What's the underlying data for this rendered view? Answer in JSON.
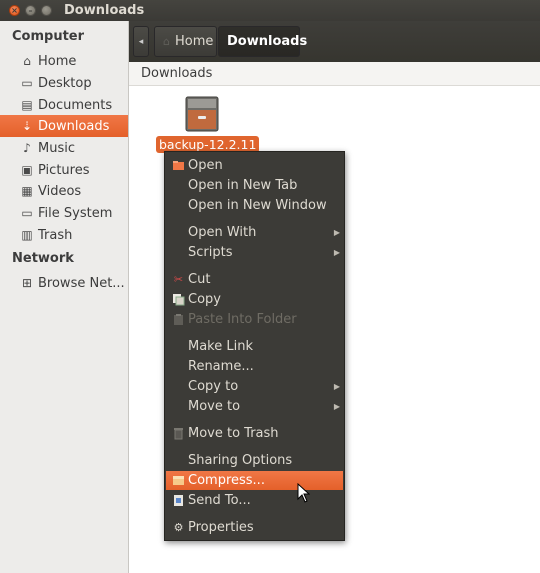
{
  "window": {
    "title": "Downloads"
  },
  "sidebar": {
    "sections": [
      {
        "heading": "Computer",
        "items": [
          {
            "label": "Home",
            "icon": "home-icon"
          },
          {
            "label": "Desktop",
            "icon": "desktop-icon"
          },
          {
            "label": "Documents",
            "icon": "documents-icon"
          },
          {
            "label": "Downloads",
            "icon": "downloads-icon",
            "active": true
          },
          {
            "label": "Music",
            "icon": "music-icon"
          },
          {
            "label": "Pictures",
            "icon": "pictures-icon"
          },
          {
            "label": "Videos",
            "icon": "videos-icon"
          },
          {
            "label": "File System",
            "icon": "filesystem-icon"
          },
          {
            "label": "Trash",
            "icon": "trash-icon"
          }
        ]
      },
      {
        "heading": "Network",
        "items": [
          {
            "label": "Browse Net...",
            "icon": "network-icon"
          }
        ]
      }
    ]
  },
  "pathbar": {
    "home": "Home",
    "current": "Downloads"
  },
  "content": {
    "location": "Downloads",
    "file": {
      "name": "backup-12.2.11",
      "icon": "archive-icon"
    }
  },
  "context_menu": {
    "items": [
      {
        "label": "Open",
        "icon": "open-folder-icon"
      },
      {
        "label": "Open in New Tab"
      },
      {
        "label": "Open in New Window"
      },
      {
        "label": "Open With",
        "submenu": true
      },
      {
        "label": "Scripts",
        "submenu": true
      },
      {
        "label": "Cut",
        "icon": "cut-icon"
      },
      {
        "label": "Copy",
        "icon": "copy-icon"
      },
      {
        "label": "Paste Into Folder",
        "icon": "paste-icon",
        "disabled": true
      },
      {
        "label": "Make Link"
      },
      {
        "label": "Rename..."
      },
      {
        "label": "Copy to",
        "submenu": true
      },
      {
        "label": "Move to",
        "submenu": true
      },
      {
        "label": "Move to Trash",
        "icon": "trash-icon"
      },
      {
        "label": "Sharing Options"
      },
      {
        "label": "Compress...",
        "icon": "archive-icon",
        "highlighted": true
      },
      {
        "label": "Send To...",
        "icon": "send-to-icon"
      },
      {
        "label": "Properties",
        "icon": "properties-icon"
      }
    ]
  },
  "colors": {
    "accent": "#e4602a",
    "menu_bg": "#3c3b37",
    "titlebar": "#3c3b37"
  }
}
